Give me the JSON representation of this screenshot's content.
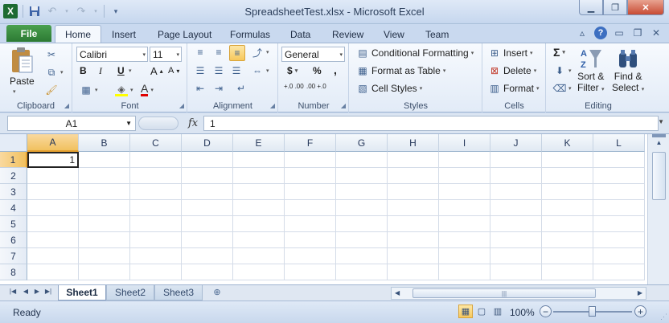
{
  "window": {
    "title": "SpreadsheetTest.xlsx  -  Microsoft Excel",
    "app_icon": "X",
    "minimize_icon": "minimize-icon",
    "maximize_icon": "restore-icon",
    "close_icon": "close-icon"
  },
  "qat": {
    "save_icon": "save-icon",
    "undo_icon": "undo-icon",
    "redo_icon": "redo-icon",
    "customize_icon": "customize-icon"
  },
  "tabs": {
    "file": "File",
    "items": [
      "Home",
      "Insert",
      "Page Layout",
      "Formulas",
      "Data",
      "Review",
      "View",
      "Team"
    ],
    "active": "Home"
  },
  "ribbon": {
    "clipboard": {
      "label": "Clipboard",
      "paste": "Paste"
    },
    "font": {
      "label": "Font",
      "name": "Calibri",
      "size": "11",
      "bold": "B",
      "italic": "I",
      "underline": "U",
      "grow": "A",
      "shrink": "A",
      "color": "A"
    },
    "alignment": {
      "label": "Alignment"
    },
    "number": {
      "label": "Number",
      "format": "General",
      "currency": "$",
      "percent": "%",
      "comma": ",",
      "inc_decimal": "+.0 .00",
      "dec_decimal": ".00 +.0"
    },
    "styles": {
      "label": "Styles",
      "conditional": "Conditional Formatting",
      "format_table": "Format as Table",
      "cell_styles": "Cell Styles"
    },
    "cells": {
      "label": "Cells",
      "insert": "Insert",
      "delete": "Delete",
      "format": "Format"
    },
    "editing": {
      "label": "Editing",
      "sum": "Σ",
      "sort_filter_1": "Sort &",
      "sort_filter_2": "Filter",
      "find_select_1": "Find &",
      "find_select_2": "Select"
    }
  },
  "formula_bar": {
    "name_box": "A1",
    "fx": "fx",
    "value": "1"
  },
  "grid": {
    "columns": [
      "A",
      "B",
      "C",
      "D",
      "E",
      "F",
      "G",
      "H",
      "I",
      "J",
      "K",
      "L"
    ],
    "rows": [
      "1",
      "2",
      "3",
      "4",
      "5",
      "6",
      "7",
      "8"
    ],
    "active_cell": "A1",
    "a1_value": "1"
  },
  "sheets": {
    "tabs": [
      "Sheet1",
      "Sheet2",
      "Sheet3"
    ],
    "active": "Sheet1"
  },
  "status": {
    "mode": "Ready",
    "zoom": "100%",
    "zoom_out": "−",
    "zoom_in": "+"
  }
}
